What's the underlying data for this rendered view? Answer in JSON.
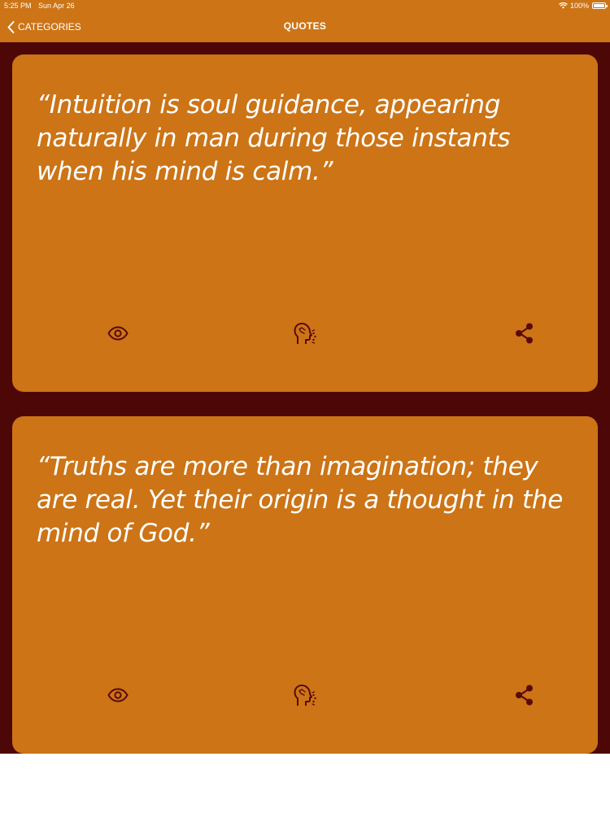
{
  "status_bar": {
    "time": "5:25 PM",
    "date": "Sun Apr 26",
    "battery": "100%"
  },
  "nav": {
    "back_label": "CATEGORIES",
    "title": "QUOTES"
  },
  "quotes": [
    {
      "text": "“Intuition is soul guidance, appearing naturally in man during those instants when his mind is calm.”"
    },
    {
      "text": "“Truths are more than imagination; they are real. Yet their origin is a thought in the mind of God.”"
    }
  ],
  "icons": {
    "view": "eye-icon",
    "speak": "speaking-head-icon",
    "share": "share-icon"
  },
  "colors": {
    "accent": "#cc7416",
    "background": "#4d0707",
    "icon": "#5a0a0a",
    "text": "#ffffff"
  }
}
